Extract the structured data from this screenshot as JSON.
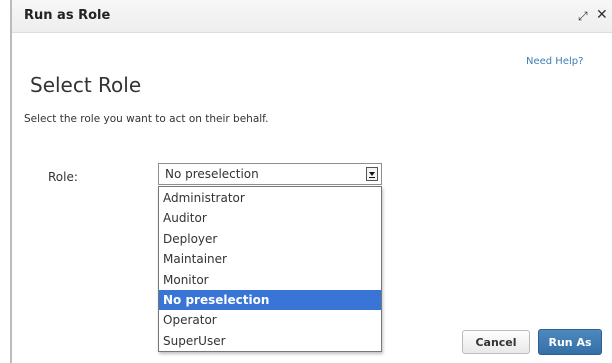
{
  "dialog": {
    "title": "Run as Role",
    "expand_glyph": "⤢",
    "close_glyph": "✕"
  },
  "help_link": "Need Help?",
  "page_title": "Select Role",
  "subtitle": "Select the role you want to act on their behalf.",
  "form": {
    "role_label": "Role:",
    "selected_value": "No preselection",
    "options": [
      "Administrator",
      "Auditor",
      "Deployer",
      "Maintainer",
      "Monitor",
      "No preselection",
      "Operator",
      "SuperUser"
    ],
    "highlighted_index": 5
  },
  "buttons": {
    "cancel": "Cancel",
    "run_as": "Run As"
  },
  "colors": {
    "highlight": "#3875d7",
    "primary_button": "#3d7cb4",
    "link": "#3d7fba"
  },
  "icons": {
    "expand": "expand-icon",
    "close": "close-icon",
    "dropdown": "dropdown-arrow-icon"
  }
}
